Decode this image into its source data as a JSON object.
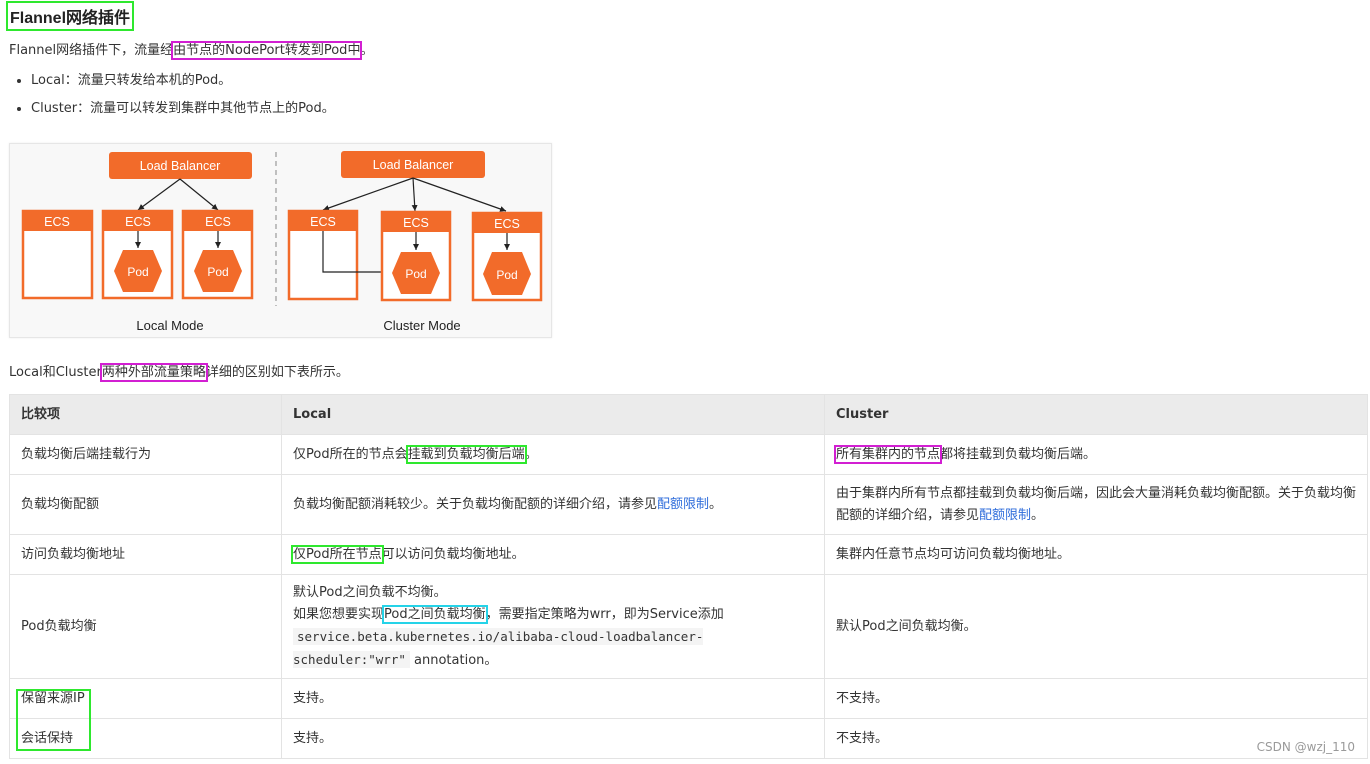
{
  "heading": "Flannel网络插件",
  "intro": {
    "before": "Flannel网络插件下，流量经",
    "highlight": "由节点的NodePort转发到Pod中",
    "after": "。"
  },
  "modes": [
    {
      "label": "Local",
      "sep": "：",
      "text": "流量只转发给本机的Pod。"
    },
    {
      "label": "Cluster",
      "sep": "：",
      "text": "流量可以转发到集群中其他节点上的Pod。"
    }
  ],
  "diagram": {
    "lb_label": "Load Balancer",
    "ecs_label": "ECS",
    "pod_label": "Pod",
    "local_caption": "Local Mode",
    "cluster_caption": "Cluster Mode",
    "accent": "#f26b2a"
  },
  "lead": {
    "before": "Local和Cluster",
    "highlight": "两种外部流量策略",
    "after": "详细的区别如下表所示。"
  },
  "table": {
    "headers": [
      "比较项",
      "Local",
      "Cluster"
    ],
    "rows": [
      {
        "item": "负载均衡后端挂载行为",
        "local_before": "仅Pod所在的节点会",
        "local_hl": "挂载到负载均衡后端",
        "local_after": "。",
        "cluster_hl": "所有集群内的节点",
        "cluster_after": "都将挂载到负载均衡后端。"
      },
      {
        "item": "负载均衡配额",
        "local_before": "负载均衡配额消耗较少。关于负载均衡配额的详细介绍，请参见",
        "local_link": "配额限制",
        "local_after": "。",
        "cluster_before": "由于集群内所有节点都挂载到负载均衡后端，因此会大量消耗负载均衡配额。关于负载均衡配额的详细介绍，请参见",
        "cluster_link": "配额限制",
        "cluster_after": "。"
      },
      {
        "item": "访问负载均衡地址",
        "local_hl": "仅Pod所在节点",
        "local_after": "可以访问负载均衡地址。",
        "cluster_text": "集群内任意节点均可访问负载均衡地址。"
      },
      {
        "item": "Pod负载均衡",
        "local_line1": "默认Pod之间负载不均衡。",
        "local_line2_before": "如果您想要实现",
        "local_line2_hl": "Pod之间负载均衡",
        "local_line2_after": "，需要指定策略为wrr，即为Service添加",
        "local_code": "service.beta.kubernetes.io/alibaba-cloud-loadbalancer-scheduler:\"wrr\"",
        "local_code_after": "annotation。",
        "cluster_text": "默认Pod之间负载均衡。"
      },
      {
        "item": "保留来源IP",
        "local_text": "支持。",
        "cluster_text": "不支持。"
      },
      {
        "item": "会话保持",
        "local_text": "支持。",
        "cluster_text": "不支持。"
      }
    ]
  },
  "watermark": "CSDN @wzj_110"
}
